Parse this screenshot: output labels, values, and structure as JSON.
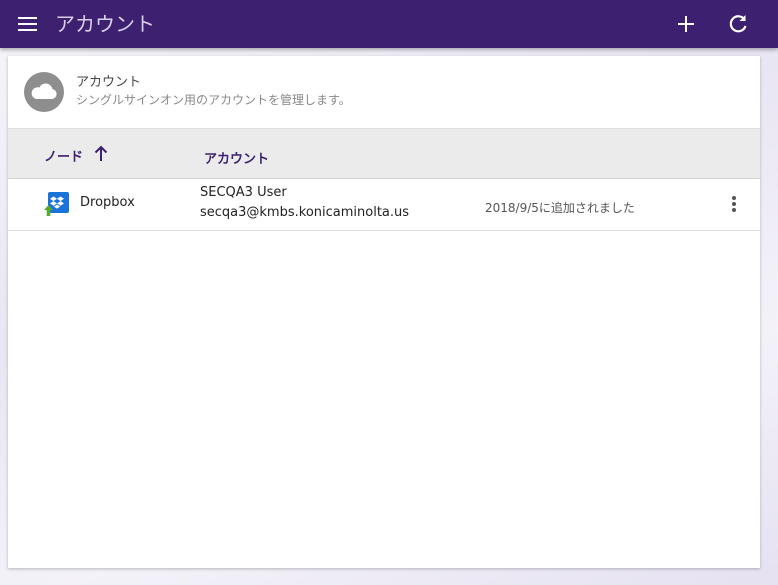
{
  "appbar": {
    "title": "アカウント",
    "icons": {
      "menu": "menu-icon",
      "add": "plus-icon",
      "refresh": "refresh-icon"
    },
    "color": "#3d2070"
  },
  "header": {
    "icon": "cloud-icon",
    "title": "アカウント",
    "subtitle": "シングルサインオン用のアカウントを管理します。"
  },
  "table": {
    "columns": [
      {
        "label": "ノード",
        "sort": "ascending"
      },
      {
        "label": "アカウント"
      }
    ],
    "rows": [
      {
        "icon": "dropbox-icon",
        "node": "Dropbox",
        "user": "SECQA3 User",
        "email": "secqa3@kmbs.konicaminolta.us",
        "added": "2018/9/5に追加されました"
      }
    ]
  }
}
